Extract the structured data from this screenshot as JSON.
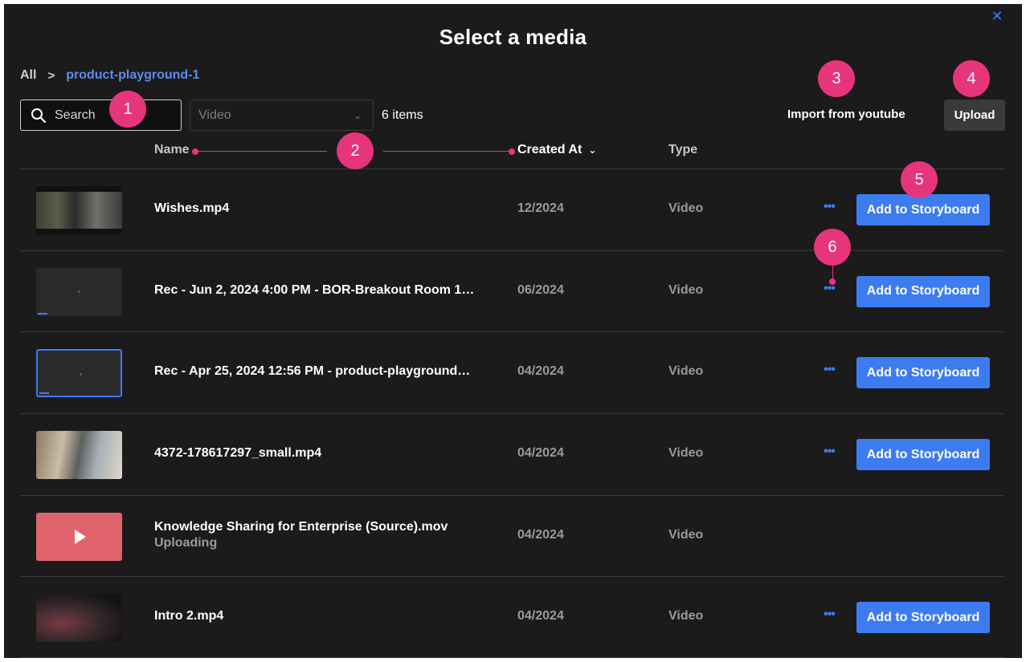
{
  "dialog": {
    "title": "Select a media",
    "close_icon": "close-icon"
  },
  "breadcrumb": {
    "root": "All",
    "separator": ">",
    "current": "product-playground-1"
  },
  "toolbar": {
    "search_placeholder": "Search",
    "filter_value": "Video",
    "items_count": "6 items",
    "import_label": "Import from youtube",
    "upload_label": "Upload"
  },
  "columns": {
    "name": "Name",
    "created": "Created At",
    "type": "Type"
  },
  "rows": [
    {
      "name": "Wishes.mp4",
      "status": "",
      "date": "12/2024",
      "type": "Video",
      "more": "•••",
      "action": "Add to Storyboard"
    },
    {
      "name": "Rec - Jun 2, 2024 4:00 PM - BOR-Breakout Room 1…",
      "status": "",
      "date": "06/2024",
      "type": "Video",
      "more": "•••",
      "action": "Add to Storyboard"
    },
    {
      "name": "Rec - Apr 25, 2024 12:56 PM - product-playground…",
      "status": "",
      "date": "04/2024",
      "type": "Video",
      "more": "•••",
      "action": "Add to Storyboard"
    },
    {
      "name": "4372-178617297_small.mp4",
      "status": "",
      "date": "04/2024",
      "type": "Video",
      "more": "•••",
      "action": "Add to Storyboard"
    },
    {
      "name": "Knowledge Sharing for Enterprise (Source).mov",
      "status": "Uploading",
      "date": "04/2024",
      "type": "Video",
      "more": "",
      "action": ""
    },
    {
      "name": "Intro 2.mp4",
      "status": "",
      "date": "04/2024",
      "type": "Video",
      "more": "•••",
      "action": "Add to Storyboard"
    }
  ],
  "annotations": {
    "c1": "1",
    "c2": "2",
    "c3": "3",
    "c4": "4",
    "c5": "5",
    "c6": "6"
  },
  "colors": {
    "accent": "#3d7bf0",
    "annotation": "#e6357a",
    "background": "#1b1b1c"
  }
}
